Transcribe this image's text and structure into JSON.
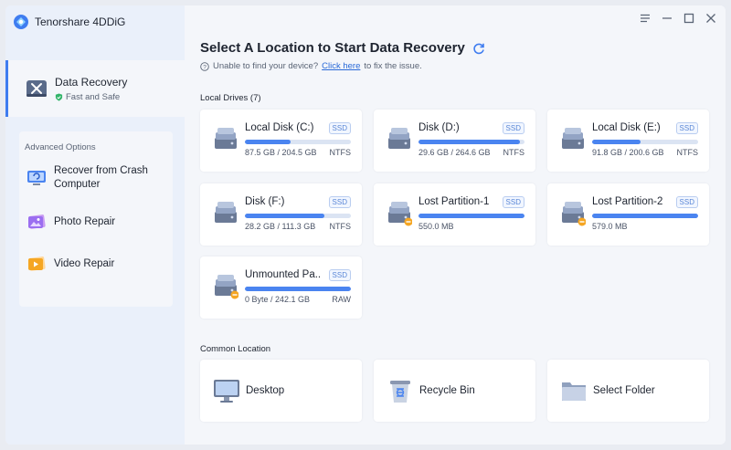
{
  "app": {
    "name": "Tenorshare 4DDiG"
  },
  "sidebar": {
    "main_item": {
      "label": "Data Recovery",
      "sublabel": "Fast and Safe"
    },
    "advanced_title": "Advanced Options",
    "advanced_items": [
      {
        "label": "Recover from Crash Computer",
        "icon": "crash-computer-icon"
      },
      {
        "label": "Photo Repair",
        "icon": "photo-repair-icon"
      },
      {
        "label": "Video Repair",
        "icon": "video-repair-icon"
      }
    ]
  },
  "header": {
    "title": "Select A Location to Start Data Recovery",
    "hint_prefix": "Unable to find your device?",
    "hint_link": "Click here",
    "hint_suffix": "to fix the issue."
  },
  "local_drives": {
    "label": "Local Drives (7)",
    "drives": [
      {
        "name": "Local Disk (C:)",
        "badge": "SSD",
        "size": "87.5 GB / 204.5 GB",
        "fs": "NTFS",
        "usage": 0.43,
        "warn": false
      },
      {
        "name": "Disk (D:)",
        "badge": "SSD",
        "size": "29.6 GB / 264.6 GB",
        "fs": "NTFS",
        "usage": 0.96,
        "warn": false
      },
      {
        "name": "Local Disk (E:)",
        "badge": "SSD",
        "size": "91.8 GB / 200.6 GB",
        "fs": "NTFS",
        "usage": 0.46,
        "warn": false
      },
      {
        "name": "Disk (F:)",
        "badge": "SSD",
        "size": "28.2 GB / 111.3 GB",
        "fs": "NTFS",
        "usage": 0.75,
        "warn": false
      },
      {
        "name": "Lost Partition-1",
        "badge": "SSD",
        "size": "550.0 MB",
        "fs": "",
        "usage": 1.0,
        "warn": true
      },
      {
        "name": "Lost Partition-2",
        "badge": "SSD",
        "size": "579.0 MB",
        "fs": "",
        "usage": 1.0,
        "warn": true
      },
      {
        "name": "Unmounted Pa...",
        "badge": "SSD",
        "size": "0 Byte / 242.1 GB",
        "fs": "RAW",
        "usage": 1.0,
        "warn": true
      }
    ]
  },
  "common": {
    "label": "Common Location",
    "items": [
      {
        "label": "Desktop",
        "icon": "desktop-icon"
      },
      {
        "label": "Recycle Bin",
        "icon": "recycle-bin-icon"
      },
      {
        "label": "Select Folder",
        "icon": "folder-icon"
      }
    ]
  },
  "colors": {
    "accent": "#3f7df0",
    "bar": "#4a84f0",
    "link": "#2a6ad8",
    "warn": "#f5a623"
  }
}
